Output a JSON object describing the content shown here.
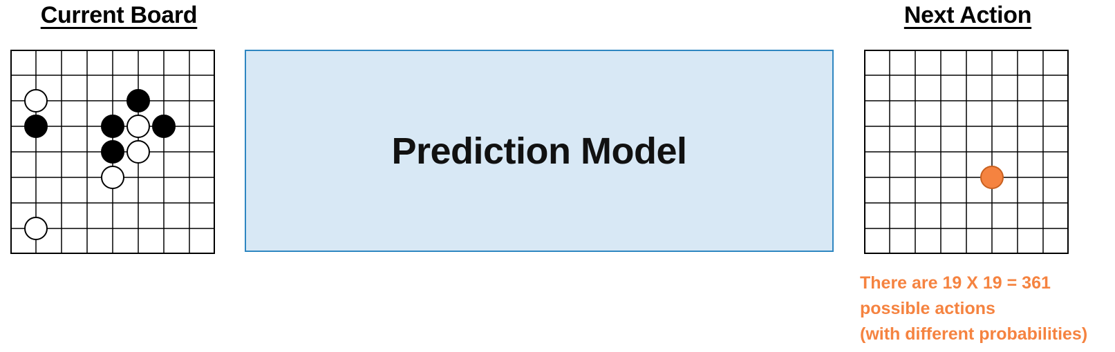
{
  "headings": {
    "left": "Current Board",
    "right": "Next Action"
  },
  "model": {
    "label": "Prediction Model"
  },
  "note": {
    "lines": [
      "There are 19 X 19 = 361",
      "possible actions",
      "(with different probabilities)"
    ]
  },
  "boards": {
    "grid_cells": 8,
    "current": {
      "stones": [
        {
          "color": "white",
          "col": 1,
          "row": 2
        },
        {
          "color": "black",
          "col": 1,
          "row": 3
        },
        {
          "color": "black",
          "col": 5,
          "row": 2
        },
        {
          "color": "black",
          "col": 4,
          "row": 3
        },
        {
          "color": "white",
          "col": 5,
          "row": 3
        },
        {
          "color": "black",
          "col": 6,
          "row": 3
        },
        {
          "color": "black",
          "col": 4,
          "row": 4
        },
        {
          "color": "white",
          "col": 5,
          "row": 4
        },
        {
          "color": "white",
          "col": 4,
          "row": 5
        },
        {
          "color": "white",
          "col": 1,
          "row": 7
        }
      ]
    },
    "next": {
      "stones": [
        {
          "color": "orange",
          "col": 5,
          "row": 5
        }
      ]
    }
  },
  "colors": {
    "model_fill": "#d8e8f5",
    "model_border": "#2e86c1",
    "note": "#f58340",
    "orange_stone": "#f58340",
    "black_stone": "#000000",
    "white_stone": "#ffffff"
  }
}
